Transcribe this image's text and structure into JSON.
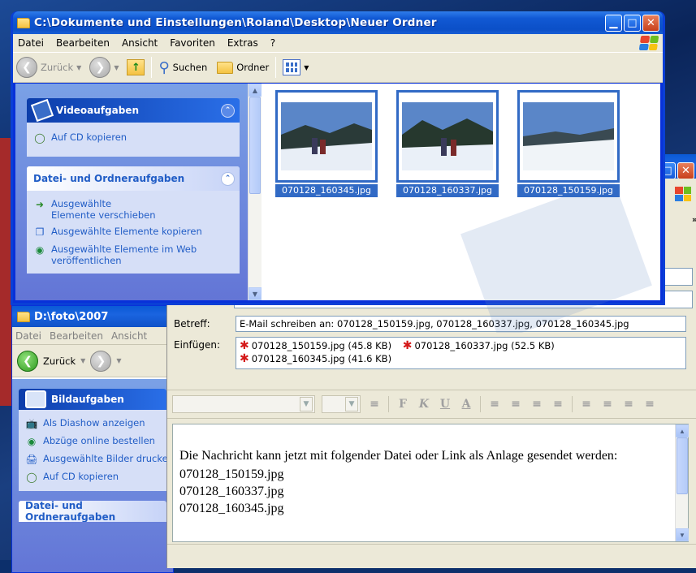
{
  "front_window": {
    "title": "C:\\Dokumente und Einstellungen\\Roland\\Desktop\\Neuer Ordner",
    "menu": [
      "Datei",
      "Bearbeiten",
      "Ansicht",
      "Favoriten",
      "Extras",
      "?"
    ],
    "toolbar": {
      "back": "Zurück",
      "search": "Suchen",
      "folders": "Ordner"
    },
    "video_tasks": {
      "title": "Videoaufgaben",
      "items": [
        "Auf CD kopieren"
      ]
    },
    "file_tasks": {
      "title": "Datei- und Ordneraufgaben",
      "items": [
        "Ausgewählte Elemente verschieben",
        "Ausgewählte Elemente kopieren",
        "Ausgewählte Elemente im Web veröffentlichen"
      ]
    },
    "thumbnails": [
      "070128_160345.jpg",
      "070128_160337.jpg",
      "070128_150159.jpg"
    ]
  },
  "back_window": {
    "title": "D:\\foto\\2007",
    "menu": [
      "Datei",
      "Bearbeiten",
      "Ansicht"
    ],
    "toolbar": {
      "back": "Zurück"
    },
    "picture_tasks": {
      "title": "Bildaufgaben",
      "items": [
        "Als Diashow anzeigen",
        "Abzüge online bestellen",
        "Ausgewählte Bilder drucken",
        "Auf CD kopieren"
      ]
    },
    "file_tasks": {
      "title": "Datei- und Ordneraufgaben"
    }
  },
  "mail_window": {
    "subject_label": "Betreff:",
    "subject_value": "E-Mail schreiben an: 070128_150159.jpg, 070128_160337.jpg, 070128_160345.jpg",
    "attach_label": "Einfügen:",
    "attachments": [
      "070128_150159.jpg (45.8 KB)",
      "070128_160337.jpg (52.5 KB)",
      "070128_160345.jpg (41.6 KB)"
    ],
    "body_lines": [
      "Die Nachricht kann jetzt mit folgender Datei oder Link als Anlage gesendet werden:",
      "070128_150159.jpg",
      "070128_160337.jpg",
      "070128_160345.jpg"
    ],
    "format_buttons": [
      "F",
      "K",
      "U",
      "A"
    ]
  }
}
